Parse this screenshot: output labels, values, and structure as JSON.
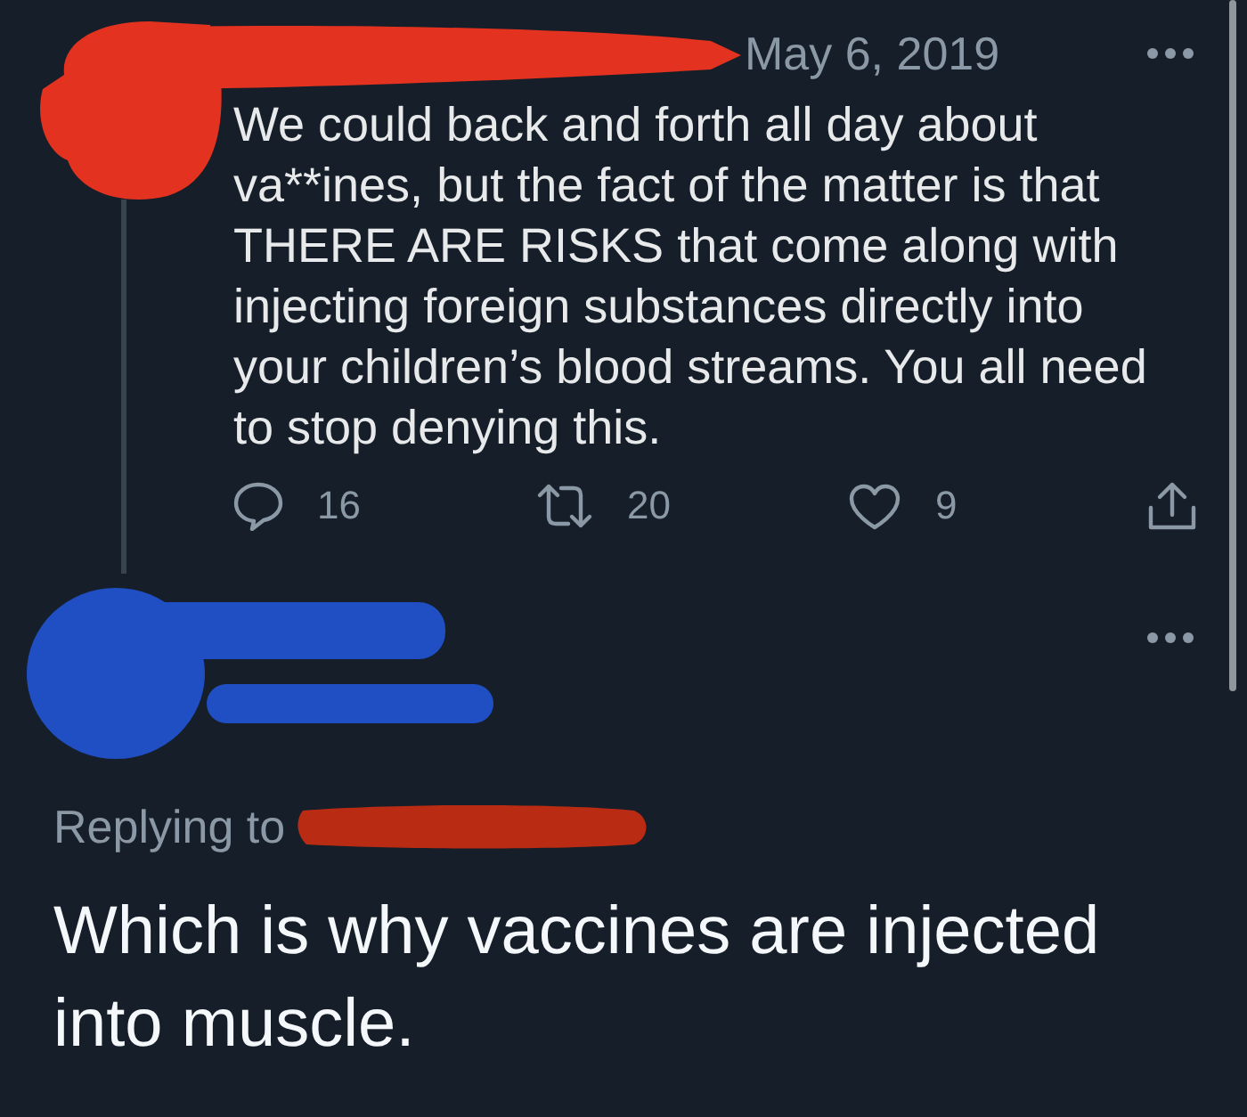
{
  "parent_tweet": {
    "author": {
      "redacted": true
    },
    "date": "May 6, 2019",
    "text": "We could back and forth all day about va**ines, but the fact of the matter is that THERE ARE RISKS that come along with injecting foreign substances directly into your children’s blood streams. You all need to stop denying this.",
    "actions": [
      {
        "kind": "reply",
        "count": "16"
      },
      {
        "kind": "retweet",
        "count": "20"
      },
      {
        "kind": "like",
        "count": "9"
      },
      {
        "kind": "share"
      }
    ]
  },
  "reply_tweet": {
    "author": {
      "redacted": true
    },
    "replying_to": {
      "label": "Replying to",
      "redacted": true
    },
    "text": "Which is why vaccines are injected into muscle."
  }
}
